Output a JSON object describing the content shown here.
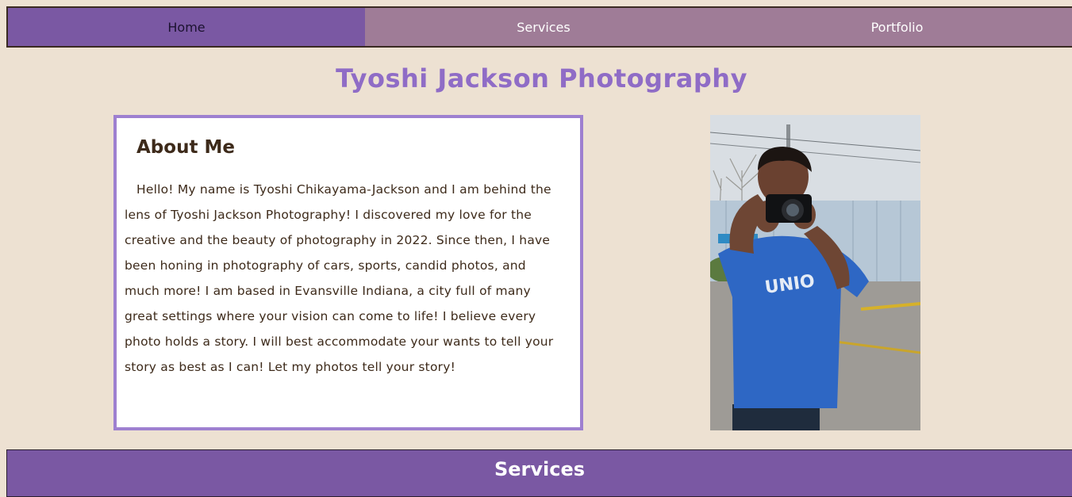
{
  "nav": {
    "items": [
      {
        "label": "Home",
        "active": true
      },
      {
        "label": "Services",
        "active": false
      },
      {
        "label": "Portfolio",
        "active": false
      }
    ]
  },
  "header": {
    "title": "Tyoshi Jackson Photography"
  },
  "about": {
    "heading": "About Me",
    "body": "Hello! My name is Tyoshi Chikayama-Jackson and I am behind the lens of Tyoshi Jackson Photography! I discovered my love for the creative and the beauty of photography in 2022. Since then, I have been honing in photography of cars, sports, candid photos, and much more! I am based in Evansville Indiana, a city full of many great settings where your vision can come to life! I believe every photo holds a story. I will best accommodate your wants to tell your story as best as I can! Let my photos tell your story!"
  },
  "photo": {
    "icon": "photographer-portrait-image"
  },
  "services": {
    "heading": "Services"
  },
  "colors": {
    "background": "#ede1d2",
    "nav_active": "#7a58a3",
    "nav_inactive": "#9f7c97",
    "title": "#8f6cc6",
    "card_border": "#9e80d0",
    "services_bar": "#7a58a3"
  }
}
